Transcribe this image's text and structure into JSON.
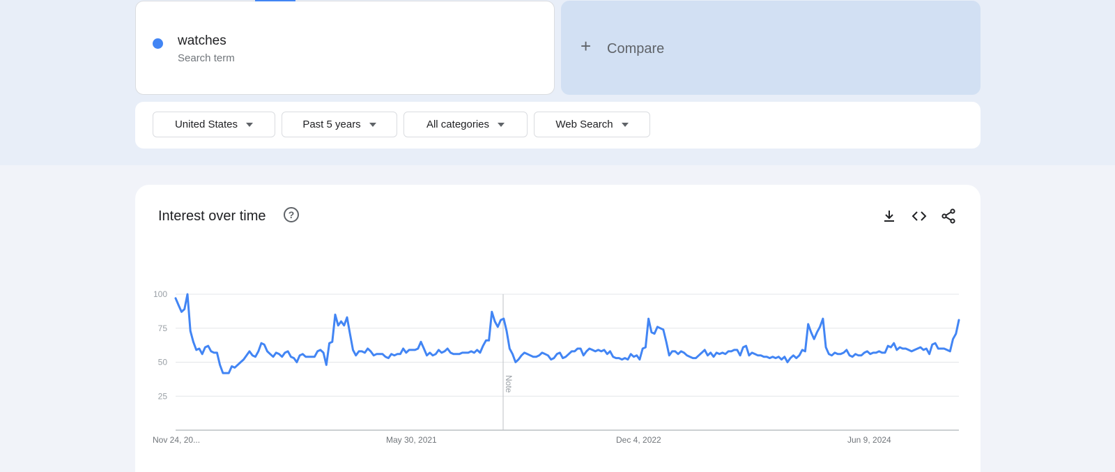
{
  "search_term": {
    "name": "watches",
    "type": "Search term",
    "color": "#4285f4"
  },
  "compare": {
    "icon": "plus-icon",
    "label": "Compare"
  },
  "filters": [
    {
      "label": "United States"
    },
    {
      "label": "Past 5 years"
    },
    {
      "label": "All categories"
    },
    {
      "label": "Web Search"
    }
  ],
  "interest_over_time": {
    "title": "Interest over time",
    "help_icon": "help-icon",
    "actions": [
      "download-icon",
      "embed-code-icon",
      "share-icon"
    ],
    "note_label": "Note"
  },
  "chart_data": {
    "type": "line",
    "series": [
      {
        "name": "watches",
        "color": "#4285f4",
        "values": [
          97,
          92,
          87,
          89,
          100,
          73,
          65,
          59,
          60,
          56,
          61,
          62,
          58,
          57,
          57,
          48,
          42,
          42,
          42,
          47,
          46,
          48,
          50,
          52,
          55,
          58,
          55,
          54,
          58,
          64,
          63,
          58,
          56,
          54,
          57,
          56,
          54,
          57,
          58,
          54,
          53,
          50,
          55,
          56,
          54,
          54,
          54,
          54,
          58,
          59,
          57,
          48,
          64,
          65,
          85,
          77,
          80,
          77,
          83,
          71,
          59,
          55,
          58,
          58,
          57,
          60,
          58,
          55,
          56,
          56,
          56,
          54,
          53,
          56,
          55,
          56,
          56,
          60,
          57,
          59,
          59,
          59,
          60,
          65,
          60,
          55,
          57,
          55,
          56,
          59,
          57,
          58,
          60,
          57,
          56,
          56,
          56,
          57,
          57,
          57,
          58,
          57,
          59,
          57,
          62,
          66,
          66,
          87,
          80,
          76,
          81,
          82,
          73,
          60,
          56,
          50,
          52,
          55,
          57,
          56,
          55,
          54,
          54,
          55,
          57,
          56,
          55,
          52,
          53,
          56,
          57,
          53,
          54,
          56,
          58,
          58,
          60,
          60,
          55,
          58,
          60,
          59,
          58,
          59,
          58,
          59,
          56,
          58,
          54,
          53,
          53,
          52,
          53,
          52,
          56,
          54,
          55,
          52,
          60,
          61,
          82,
          72,
          71,
          76,
          75,
          74,
          65,
          55,
          58,
          58,
          56,
          58,
          57,
          55,
          54,
          53,
          53,
          55,
          57,
          59,
          55,
          57,
          54,
          57,
          56,
          57,
          56,
          58,
          58,
          59,
          59,
          55,
          61,
          62,
          55,
          57,
          56,
          55,
          55,
          54,
          54,
          53,
          54,
          53,
          54,
          52,
          54,
          50,
          53,
          55,
          53,
          55,
          59,
          58,
          78,
          72,
          67,
          72,
          76,
          82,
          61,
          56,
          55,
          57,
          56,
          56,
          57,
          59,
          55,
          54,
          56,
          55,
          55,
          57,
          58,
          56,
          57,
          57,
          58,
          57,
          57,
          62,
          61,
          64,
          59,
          61,
          60,
          60,
          59,
          58,
          59,
          60,
          61,
          59,
          60,
          56,
          63,
          64,
          60,
          60,
          60,
          59,
          58,
          67,
          71,
          81
        ]
      }
    ],
    "x_tick_labels": [
      "Nov 24, 20...",
      "May 30, 2021",
      "Dec 4, 2022",
      "Jun 9, 2024"
    ],
    "y_ticks": [
      25,
      50,
      75,
      100
    ],
    "ylim": [
      0,
      100
    ],
    "grid": true,
    "annotation": "Note"
  }
}
